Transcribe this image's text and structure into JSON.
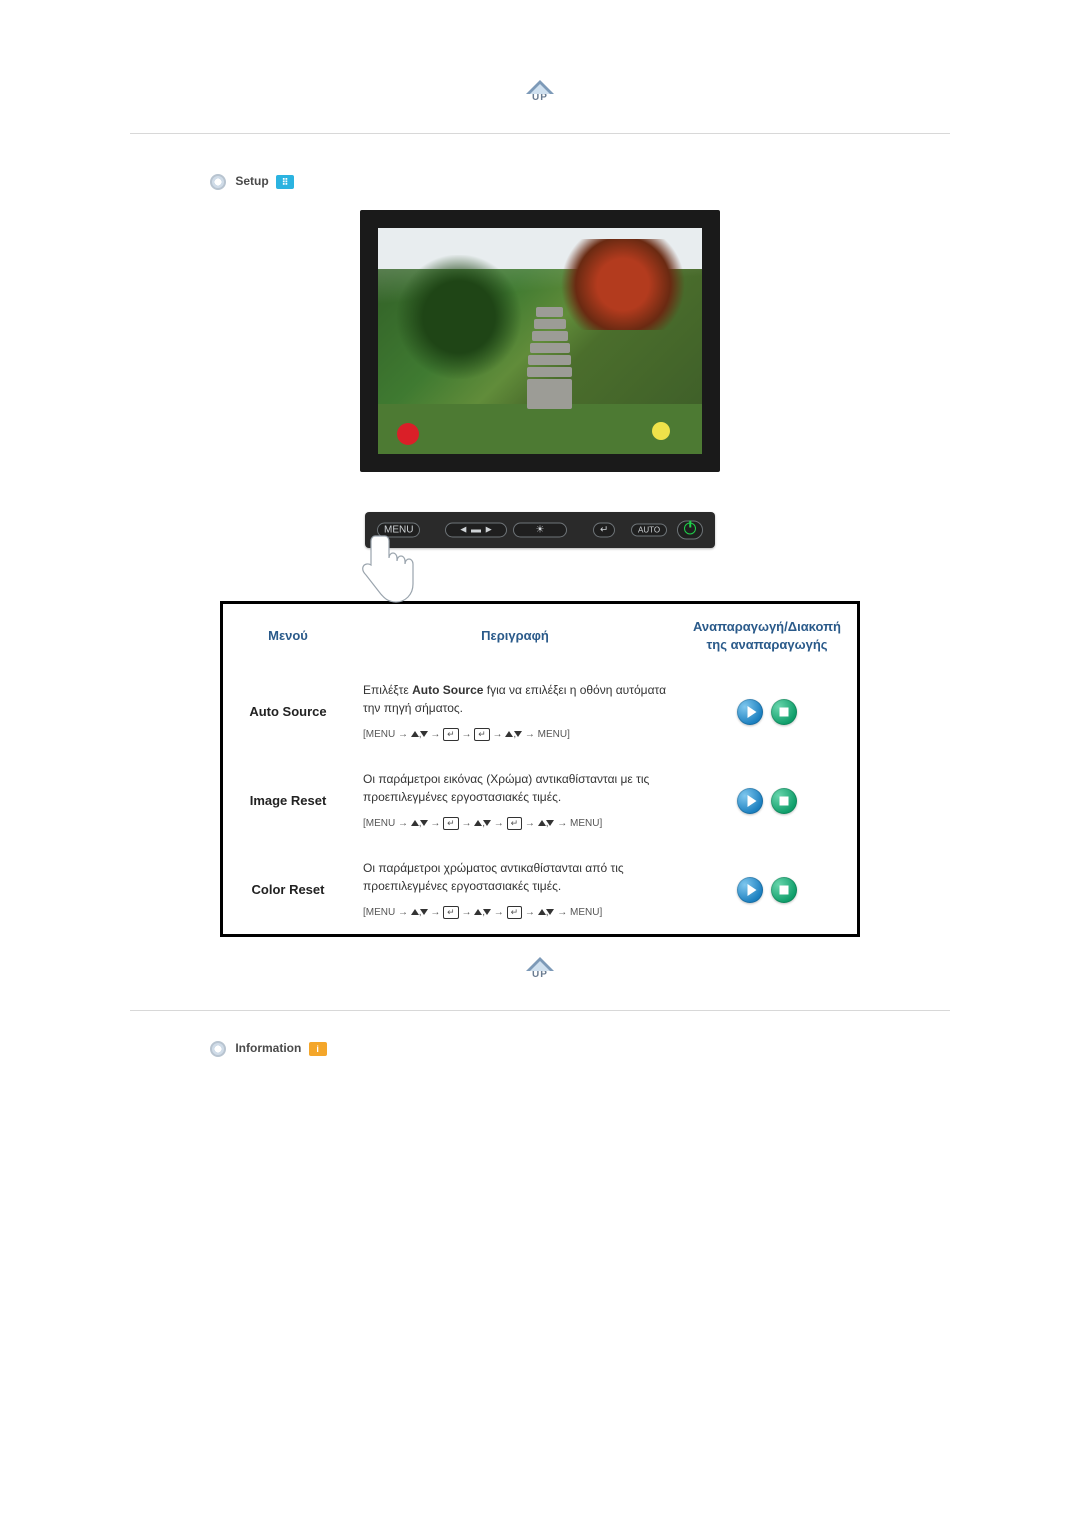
{
  "up_button": {
    "label": "UP"
  },
  "sections": {
    "setup": {
      "title": "Setup"
    },
    "information": {
      "title": "Information"
    }
  },
  "monitor_buttons": {
    "menu": "MENU",
    "adjust": "◄ ▬ ►",
    "brightness": "☀",
    "enter": "↵",
    "auto": "AUTO",
    "power": ""
  },
  "table": {
    "headers": {
      "menu": "Μενού",
      "description": "Περιγραφή",
      "playback": "Αναπαραγωγή/Διακοπή της αναπαραγωγής"
    },
    "rows": [
      {
        "menu": "Auto Source",
        "desc_prefix": "Επιλέξτε ",
        "desc_bold": "Auto Source",
        "desc_suffix": " fγια να επιλέξει η οθόνη αυτόματα την πηγή σήματος.",
        "sequence_plain": "[MENU → ▲,▼ → ↵ → ↵ → ▲,▼ → MENU]"
      },
      {
        "menu": "Image Reset",
        "desc_prefix": "",
        "desc_bold": "",
        "desc_suffix": "Οι παράμετροι εικόνας (Χρώμα) αντικαθίστανται με τις προεπιλεγμένες εργοστασιακές τιμές.",
        "sequence_plain": "[MENU → ▲,▼ → ↵ → ▲,▼ → ↵ → ▲,▼ → MENU]"
      },
      {
        "menu": "Color Reset",
        "desc_prefix": "",
        "desc_bold": "",
        "desc_suffix": "Οι παράμετροι χρώματος αντικαθίστανται από τις προεπιλεγμένες εργοστασιακές τιμές.",
        "sequence_plain": "[MENU → ▲,▼ → ↵ → ▲,▼ → ↵ → ▲,▼ → MENU]"
      }
    ]
  }
}
